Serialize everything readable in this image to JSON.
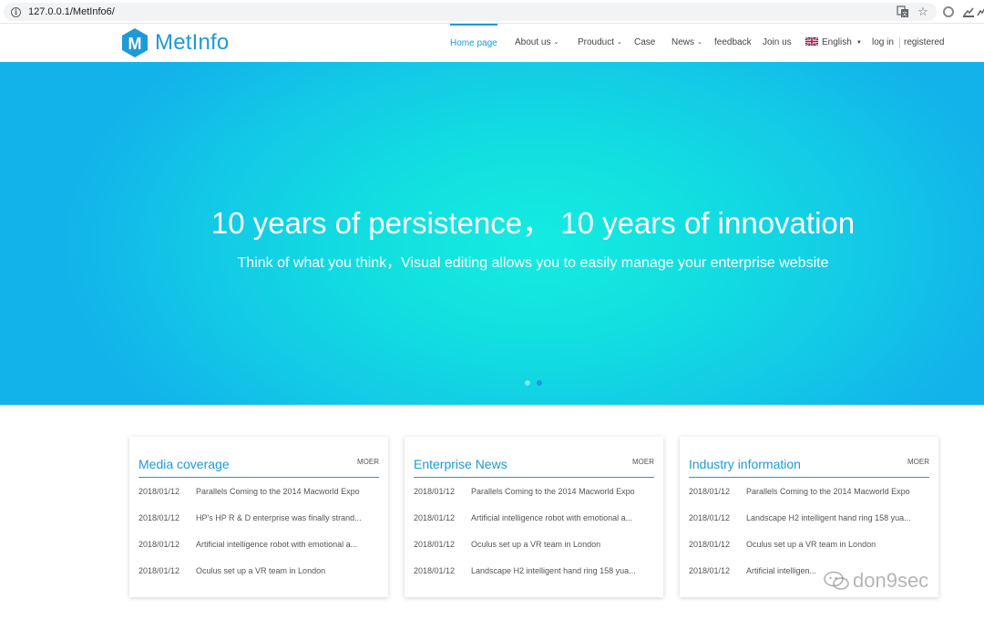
{
  "browser": {
    "url": "127.0.0.1/MetInfo6/",
    "icons": [
      "info-icon",
      "translate-icon",
      "star-icon",
      "circle-icon",
      "extension-icon",
      "extension-icon"
    ]
  },
  "header": {
    "logo_text": "MetInfo",
    "logo_letter": "M",
    "nav": {
      "home": "Home page",
      "about": "About us",
      "product": "Prouduct",
      "case": "Case",
      "news": "News",
      "feedback": "feedback",
      "join": "Join us",
      "language": "English",
      "login": "log in",
      "register": "registered"
    }
  },
  "hero": {
    "title": "10 years of persistence，  10 years of innovation",
    "subtitle": "Think of what you think，Visual editing allows you to easily manage your enterprise website",
    "active_slide": 2,
    "slide_count": 2
  },
  "cards": [
    {
      "title": "Media coverage",
      "more": "MOER",
      "rows": [
        {
          "date": "2018/01/12",
          "title": "Parallels Coming to the 2014 Macworld Expo"
        },
        {
          "date": "2018/01/12",
          "title": "HP's HP R & D enterprise was finally strand..."
        },
        {
          "date": "2018/01/12",
          "title": "Artificial intelligence robot with emotional a..."
        },
        {
          "date": "2018/01/12",
          "title": "Oculus set up a VR team in London"
        }
      ]
    },
    {
      "title": "Enterprise News",
      "more": "MOER",
      "rows": [
        {
          "date": "2018/01/12",
          "title": "Parallels Coming to the 2014 Macworld Expo"
        },
        {
          "date": "2018/01/12",
          "title": "Artificial intelligence robot with emotional a..."
        },
        {
          "date": "2018/01/12",
          "title": "Oculus set up a VR team in London"
        },
        {
          "date": "2018/01/12",
          "title": "Landscape H2 intelligent hand ring 158 yua..."
        }
      ]
    },
    {
      "title": "Industry information",
      "more": "MOER",
      "rows": [
        {
          "date": "2018/01/12",
          "title": "Parallels Coming to the 2014 Macworld Expo"
        },
        {
          "date": "2018/01/12",
          "title": "Landscape H2 intelligent hand ring 158 yua..."
        },
        {
          "date": "2018/01/12",
          "title": "Oculus set up a VR team in London"
        },
        {
          "date": "2018/01/12",
          "title": "Artificial intelligen..."
        }
      ]
    }
  ],
  "watermark": "don9sec",
  "colors": {
    "accent": "#1e9ad6",
    "hero_center": "#14ece0",
    "hero_edge": "#12b3ea"
  }
}
